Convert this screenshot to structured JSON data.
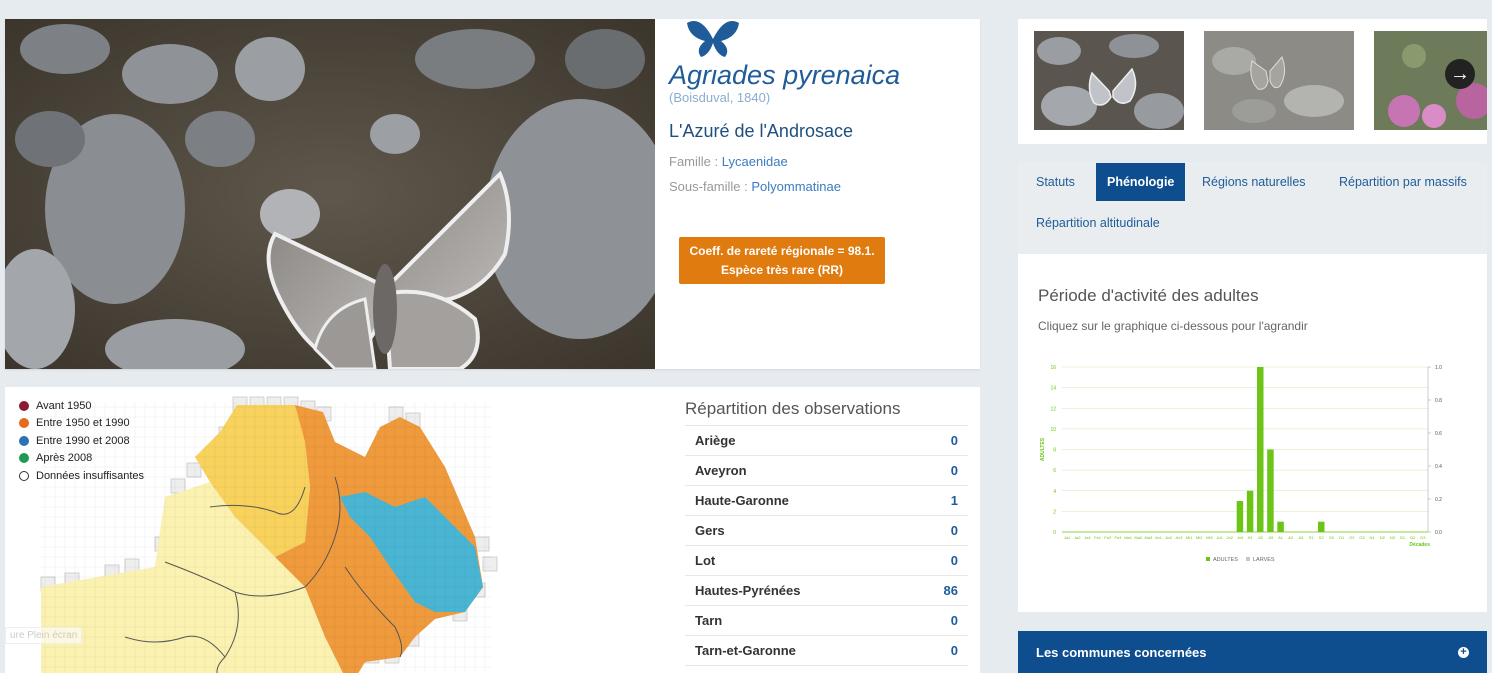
{
  "species": {
    "scientific_name": "Agriades pyrenaica",
    "author": "(Boisduval, 1840)",
    "common_name": "L'Azuré de l'Androsace",
    "family_label": "Famille : ",
    "family": "Lycaenidae",
    "subfamily_label": "Sous-famille : ",
    "subfamily": "Polyommatinae",
    "rarity_line1": "Coeff. de rareté régionale = 98.1.",
    "rarity_line2": "Espèce très rare (RR)"
  },
  "legend": [
    {
      "label": "Avant 1950",
      "color": "#8b1a33"
    },
    {
      "label": "Entre 1950 et 1990",
      "color": "#e86a1e"
    },
    {
      "label": "Entre 1990 et 2008",
      "color": "#2a73b8"
    },
    {
      "label": "Après 2008",
      "color": "#1f9a55"
    },
    {
      "label": "Données insuffisantes",
      "color": "#ffffff"
    }
  ],
  "fullscreen_label": "ure Plein écran",
  "observations": {
    "title": "Répartition des observations",
    "rows": [
      {
        "name": "Ariège",
        "value": "0"
      },
      {
        "name": "Aveyron",
        "value": "0"
      },
      {
        "name": "Haute-Garonne",
        "value": "1"
      },
      {
        "name": "Gers",
        "value": "0"
      },
      {
        "name": "Lot",
        "value": "0"
      },
      {
        "name": "Hautes-Pyrénées",
        "value": "86"
      },
      {
        "name": "Tarn",
        "value": "0"
      },
      {
        "name": "Tarn-et-Garonne",
        "value": "0"
      }
    ]
  },
  "tabs": [
    {
      "label": "Statuts",
      "active": false
    },
    {
      "label": "Phénologie",
      "active": true
    },
    {
      "label": "Régions naturelles",
      "active": false
    },
    {
      "label": "Répartition par massifs",
      "active": false
    },
    {
      "label": "Répartition altitudinale",
      "active": false
    }
  ],
  "phenology": {
    "title": "Période d'activité des adultes",
    "subtitle": "Cliquez sur le graphique ci-dessous pour l'agrandir"
  },
  "chart_data": {
    "type": "bar",
    "ylabel": "ADULTES",
    "xlabel": "Décades",
    "ylim": [
      0,
      16
    ],
    "y2lim": [
      0,
      1.0
    ],
    "yticks": [
      "0",
      "2",
      "4",
      "6",
      "8",
      "10",
      "12",
      "14",
      "16"
    ],
    "y2ticks": [
      "0.0",
      "0.2",
      "0.4",
      "0.6",
      "0.8",
      "1.0"
    ],
    "categories": [
      "Ja1",
      "Ja2",
      "Ja3",
      "Fe1",
      "Fe2",
      "Fe3",
      "Ma1",
      "Ma2",
      "Ma3",
      "Av1",
      "Av2",
      "Av3",
      "Mi1",
      "Mi2",
      "Mi3",
      "Jn1",
      "Jn2",
      "Jn3",
      "Jt1",
      "Jt2",
      "Jt3",
      "A1",
      "A2",
      "A3",
      "S1",
      "S2",
      "S3",
      "O1",
      "O2",
      "O3",
      "N1",
      "N2",
      "N3",
      "D1",
      "D2",
      "D3"
    ],
    "series": [
      {
        "name": "ADULTES",
        "color": "#6cc417",
        "values": [
          0,
          0,
          0,
          0,
          0,
          0,
          0,
          0,
          0,
          0,
          0,
          0,
          0,
          0,
          0,
          0,
          0,
          3,
          4,
          16,
          8,
          1,
          0,
          0,
          0,
          1,
          0,
          0,
          0,
          0,
          0,
          0,
          0,
          0,
          0,
          0
        ]
      },
      {
        "name": "LARVES",
        "color": "#c8c8c8",
        "values": [
          0,
          0,
          0,
          0,
          0,
          0,
          0,
          0,
          0,
          0,
          0,
          0,
          0,
          0,
          0,
          0,
          0,
          0,
          0,
          0,
          0,
          0,
          0,
          0,
          0,
          0,
          0,
          0,
          0,
          0,
          0,
          0,
          0,
          0,
          0,
          0
        ]
      }
    ]
  },
  "communes_label": "Les communes concernées"
}
